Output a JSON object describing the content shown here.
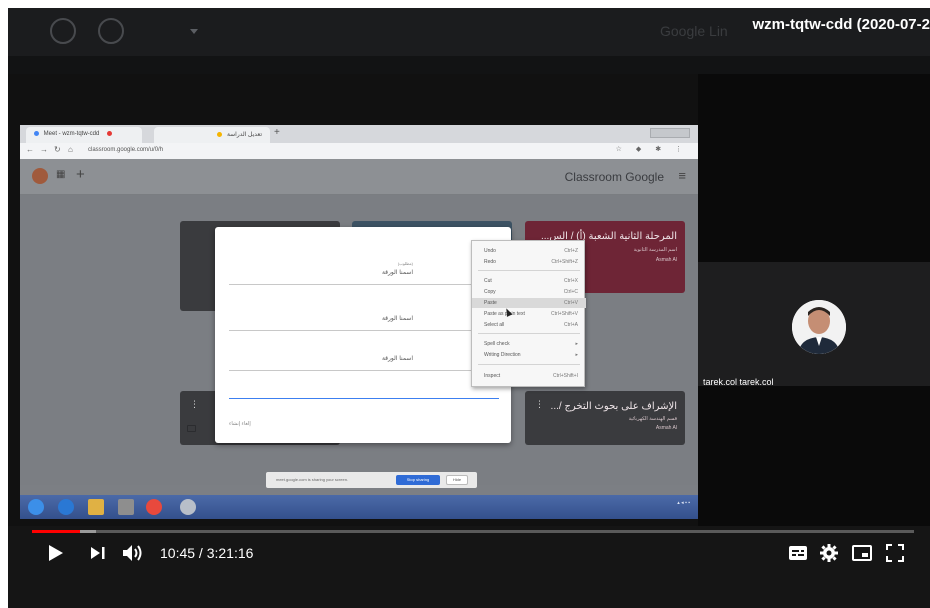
{
  "video": {
    "title": "wzm-tqtw-cdd (2020-07-2",
    "background_text": "Google Lin"
  },
  "shared_screen": {
    "tabs": [
      {
        "label": "Meet - wzm-tqtw-cdd",
        "dot_color": "#e53935"
      },
      {
        "label": "تعديل الدراسة",
        "dot_color": "#f5b400"
      }
    ],
    "address_url": "classroom.google.com/u/0/h",
    "classroom_logo": "Classroom Google",
    "cards": [
      {
        "title": "المرحلة الثانية الشعبة (أ) / الس...",
        "subtitle": "اسم المدرسة الثانوية",
        "meta": "Asmah Al"
      },
      {
        "title": "الإشراف على بحوث التخرج /...",
        "subtitle": "قسم الهندسة الكهربائية",
        "meta": "Asmah Al"
      }
    ],
    "dialog": {
      "fields": [
        {
          "label": "اسمنا الورقة",
          "hint": "(مطلوب)"
        },
        {
          "label": "اسمنا الورقة",
          "hint": ""
        },
        {
          "label": "اسمنا الورقة",
          "hint": ""
        }
      ],
      "actions": "إلغاء   إنشاء"
    },
    "context_menu": [
      {
        "label": "Undo",
        "shortcut": "Ctrl+Z"
      },
      {
        "label": "Redo",
        "shortcut": "Ctrl+Shift+Z"
      },
      {
        "label": "Cut",
        "shortcut": "Ctrl+X"
      },
      {
        "label": "Copy",
        "shortcut": "Ctrl+C"
      },
      {
        "label": "Paste",
        "shortcut": "Ctrl+V"
      },
      {
        "label": "Paste as plain text",
        "shortcut": "Ctrl+Shift+V"
      },
      {
        "label": "Select all",
        "shortcut": "Ctrl+A"
      },
      {
        "label": "Spell check",
        "shortcut": "▸"
      },
      {
        "label": "Writing Direction",
        "shortcut": "▸"
      },
      {
        "label": "Inspect",
        "shortcut": "Ctrl+Shift+I"
      }
    ],
    "share_notice": {
      "message": "meet.google.com is sharing your screen.",
      "stop_label": "Stop sharing",
      "hide_label": "Hide"
    }
  },
  "participant": {
    "name": "tarek.col tarek.col"
  },
  "player": {
    "current_time": "10:45",
    "duration": "3:21:16",
    "progress_fraction": 0.054,
    "loaded_fraction": 0.072,
    "accent_color": "#ff0000"
  }
}
